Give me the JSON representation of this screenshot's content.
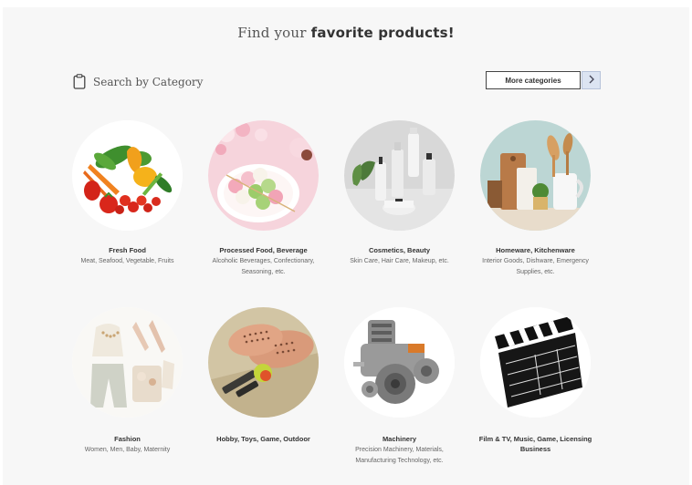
{
  "header": {
    "title_prefix": "Find your ",
    "title_emphasis": "favorite products!"
  },
  "section": {
    "title": "Search by Category",
    "more_label": "More categories",
    "more_icon": "chevron-right-icon"
  },
  "categories": [
    {
      "name": "Fresh Food",
      "sub": "Meat, Seafood, Vegetable, Fruits"
    },
    {
      "name": "Processed Food, Beverage",
      "sub": "Alcoholic Beverages, Confectionary, Seasoning, etc."
    },
    {
      "name": "Cosmetics, Beauty",
      "sub": "Skin Care, Hair Care, Makeup, etc."
    },
    {
      "name": "Homeware, Kitchenware",
      "sub": "Interior Goods, Dishware, Emergency Supplies, etc."
    },
    {
      "name": "Fashion",
      "sub": "Women, Men, Baby, Maternity"
    },
    {
      "name": "Hobby, Toys, Game, Outdoor",
      "sub": ""
    },
    {
      "name": "Machinery",
      "sub": "Precision Machinery, Materials, Manufacturing Technology, etc."
    },
    {
      "name": "Film & TV, Music, Game, Licensing Business",
      "sub": ""
    }
  ],
  "colors": {
    "background": "#f7f7f7",
    "button_border": "#444444",
    "arrow_bg": "#dce4f2"
  }
}
